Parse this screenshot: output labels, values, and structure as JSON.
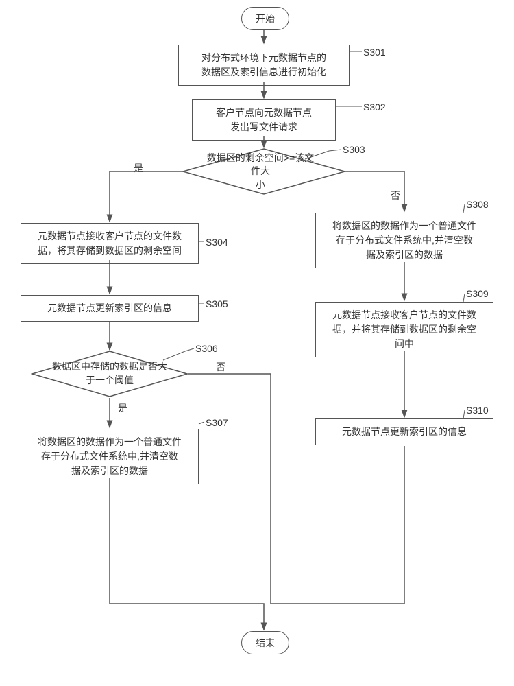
{
  "flow": {
    "start": "开始",
    "end": "结束",
    "s301": {
      "label": "S301",
      "text": "对分布式环境下元数据节点的\n数据区及索引信息进行初始化"
    },
    "s302": {
      "label": "S302",
      "text": "客户节点向元数据节点\n发出写文件请求"
    },
    "s303": {
      "label": "S303",
      "text": "数据区的剩余空间>=该文件大\n小",
      "yes": "是",
      "no": "否"
    },
    "s304": {
      "label": "S304",
      "text": "元数据节点接收客户节点的文件数\n据，将其存储到数据区的剩余空间"
    },
    "s305": {
      "label": "S305",
      "text": "元数据节点更新索引区的信息"
    },
    "s306": {
      "label": "S306",
      "text": "数据区中存储的数据是否大\n于一个阈值",
      "yes": "是",
      "no": "否"
    },
    "s307": {
      "label": "S307",
      "text": "将数据区的数据作为一个普通文件\n存于分布式文件系统中,并清空数\n据及索引区的数据"
    },
    "s308": {
      "label": "S308",
      "text": "将数据区的数据作为一个普通文件\n存于分布式文件系统中,并清空数\n据及索引区的数据"
    },
    "s309": {
      "label": "S309",
      "text": "元数据节点接收客户节点的文件数\n据，并将其存储到数据区的剩余空\n间中"
    },
    "s310": {
      "label": "S310",
      "text": "元数据节点更新索引区的信息"
    }
  }
}
